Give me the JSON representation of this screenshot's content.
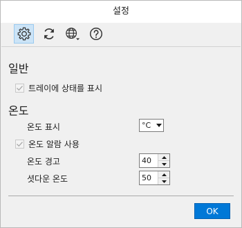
{
  "window": {
    "title": "설정"
  },
  "toolbar": {
    "items": [
      {
        "icon": "gear-icon",
        "selected": true
      },
      {
        "icon": "refresh-icon",
        "selected": false
      },
      {
        "icon": "globe-icon",
        "selected": false
      },
      {
        "icon": "help-icon",
        "selected": false
      }
    ]
  },
  "general": {
    "title": "일반",
    "tray_status_label": "트레이에 상태를 표시",
    "tray_status_checked": true
  },
  "temperature": {
    "title": "온도",
    "display_label": "온도 표시",
    "unit_value": "°C",
    "alarm_label": "온도 알람 사용",
    "alarm_checked": true,
    "warning_label": "온도 경고",
    "warning_value": "40",
    "shutdown_label": "셧다운 온도",
    "shutdown_value": "50"
  },
  "footer": {
    "ok_label": "OK"
  },
  "colors": {
    "accent": "#0078d7",
    "selected_tool": "#cce4f7",
    "background": "#f0f0f0"
  }
}
